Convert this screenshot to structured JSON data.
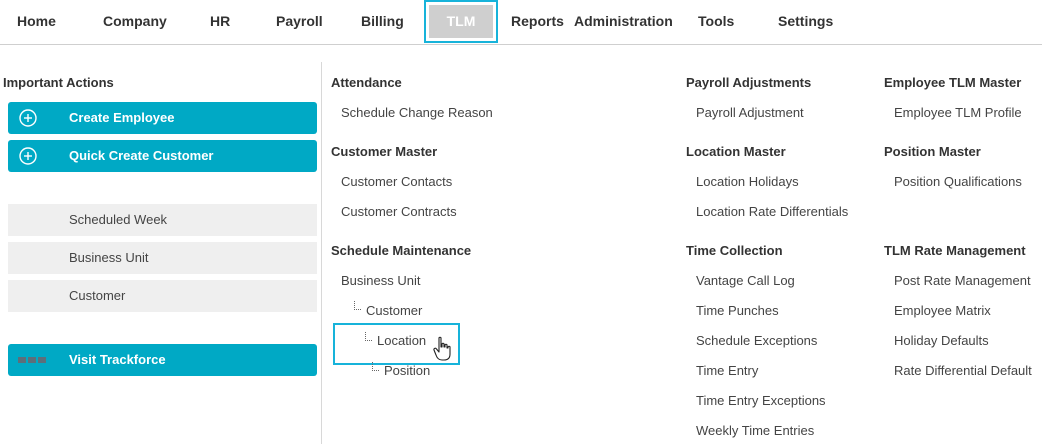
{
  "topnav": {
    "items": [
      "Home",
      "Company",
      "HR",
      "Payroll",
      "Billing",
      "TLM",
      "Reports",
      "Administration",
      "Tools",
      "Settings"
    ],
    "active": "TLM"
  },
  "left": {
    "title": "Important Actions",
    "actions": [
      "Create Employee",
      "Quick Create Customer"
    ],
    "filters": [
      "Scheduled Week",
      "Business Unit",
      "Customer"
    ],
    "trackforce": "Visit Trackforce"
  },
  "col1": {
    "attendance": {
      "heading": "Attendance",
      "links": [
        "Schedule Change Reason"
      ]
    },
    "customer_master": {
      "heading": "Customer Master",
      "links": [
        "Customer Contacts",
        "Customer Contracts"
      ]
    },
    "schedule_maintenance": {
      "heading": "Schedule Maintenance",
      "links": [
        "Business Unit",
        "Customer",
        "Location",
        "Position"
      ]
    }
  },
  "col2": {
    "payroll_adjustments": {
      "heading": "Payroll Adjustments",
      "links": [
        "Payroll Adjustment"
      ]
    },
    "location_master": {
      "heading": "Location Master",
      "links": [
        "Location Holidays",
        "Location Rate Differentials"
      ]
    },
    "time_collection": {
      "heading": "Time Collection",
      "links": [
        "Vantage Call Log",
        "Time Punches",
        "Schedule Exceptions",
        "Time Entry",
        "Time Entry Exceptions",
        "Weekly Time Entries"
      ]
    }
  },
  "col3": {
    "employee_tlm_master": {
      "heading": "Employee TLM Master",
      "links": [
        "Employee TLM Profile"
      ]
    },
    "position_master": {
      "heading": "Position Master",
      "links": [
        "Position Qualifications"
      ]
    },
    "tlm_rate_management": {
      "heading": "TLM Rate Management",
      "links": [
        "Post Rate Management",
        "Employee Matrix",
        "Holiday Defaults",
        "Rate Differential Default"
      ]
    }
  },
  "colors": {
    "accent": "#00a9c5",
    "highlight": "#17b3da",
    "active_tab_bg": "#cfcfcf"
  },
  "icons": [
    "plus-circle-icon",
    "trackforce-logo-icon",
    "hand-pointer-cursor-icon"
  ]
}
